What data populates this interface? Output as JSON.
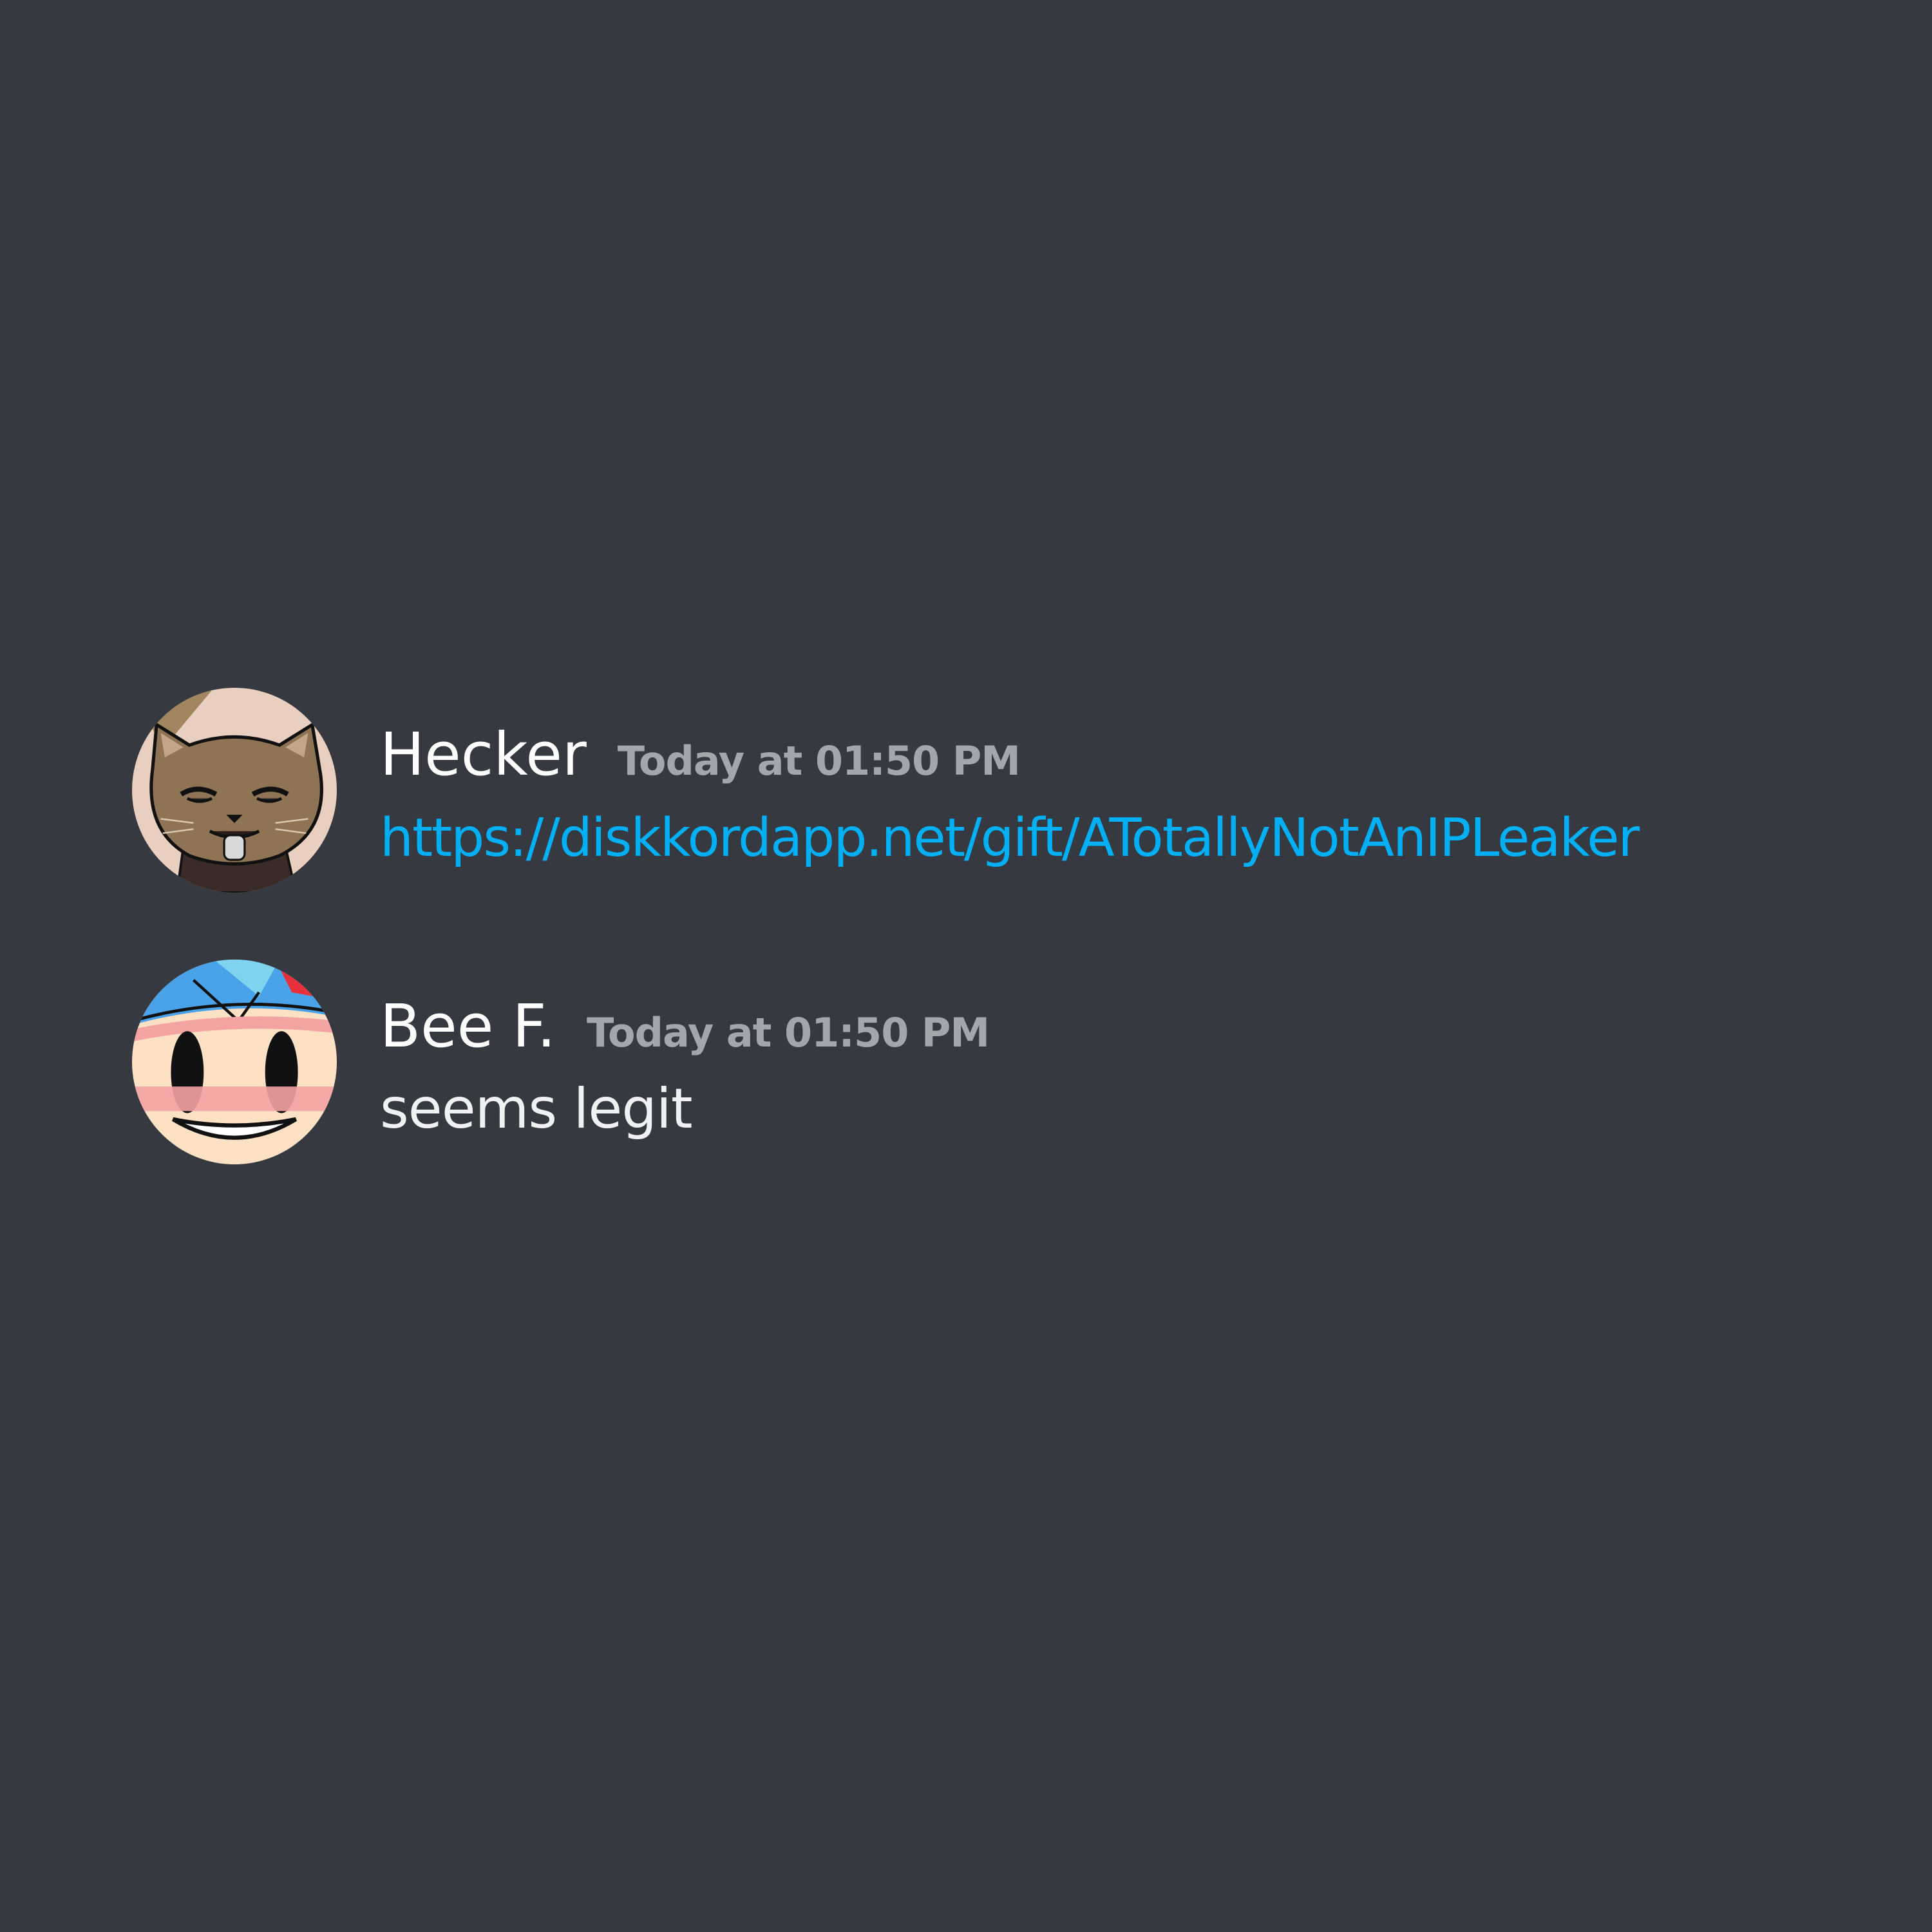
{
  "messages": [
    {
      "author": "Hecker",
      "timestamp": "Today at 01:50 PM",
      "content": "https://diskkordapp.net/gift/ATotallyNotAnIPLeaker",
      "content_is_link": true,
      "avatar_icon": "cat-avatar-icon"
    },
    {
      "author": "Bee F.",
      "timestamp": "Today at 01:50 PM",
      "content": "seems legit",
      "content_is_link": false,
      "avatar_icon": "smiley-face-avatar-icon"
    }
  ],
  "colors": {
    "background": "#36393f",
    "username": "#ffffff",
    "timestamp": "#a3a6aa",
    "link": "#00aff4",
    "text": "#f0f1f2"
  }
}
